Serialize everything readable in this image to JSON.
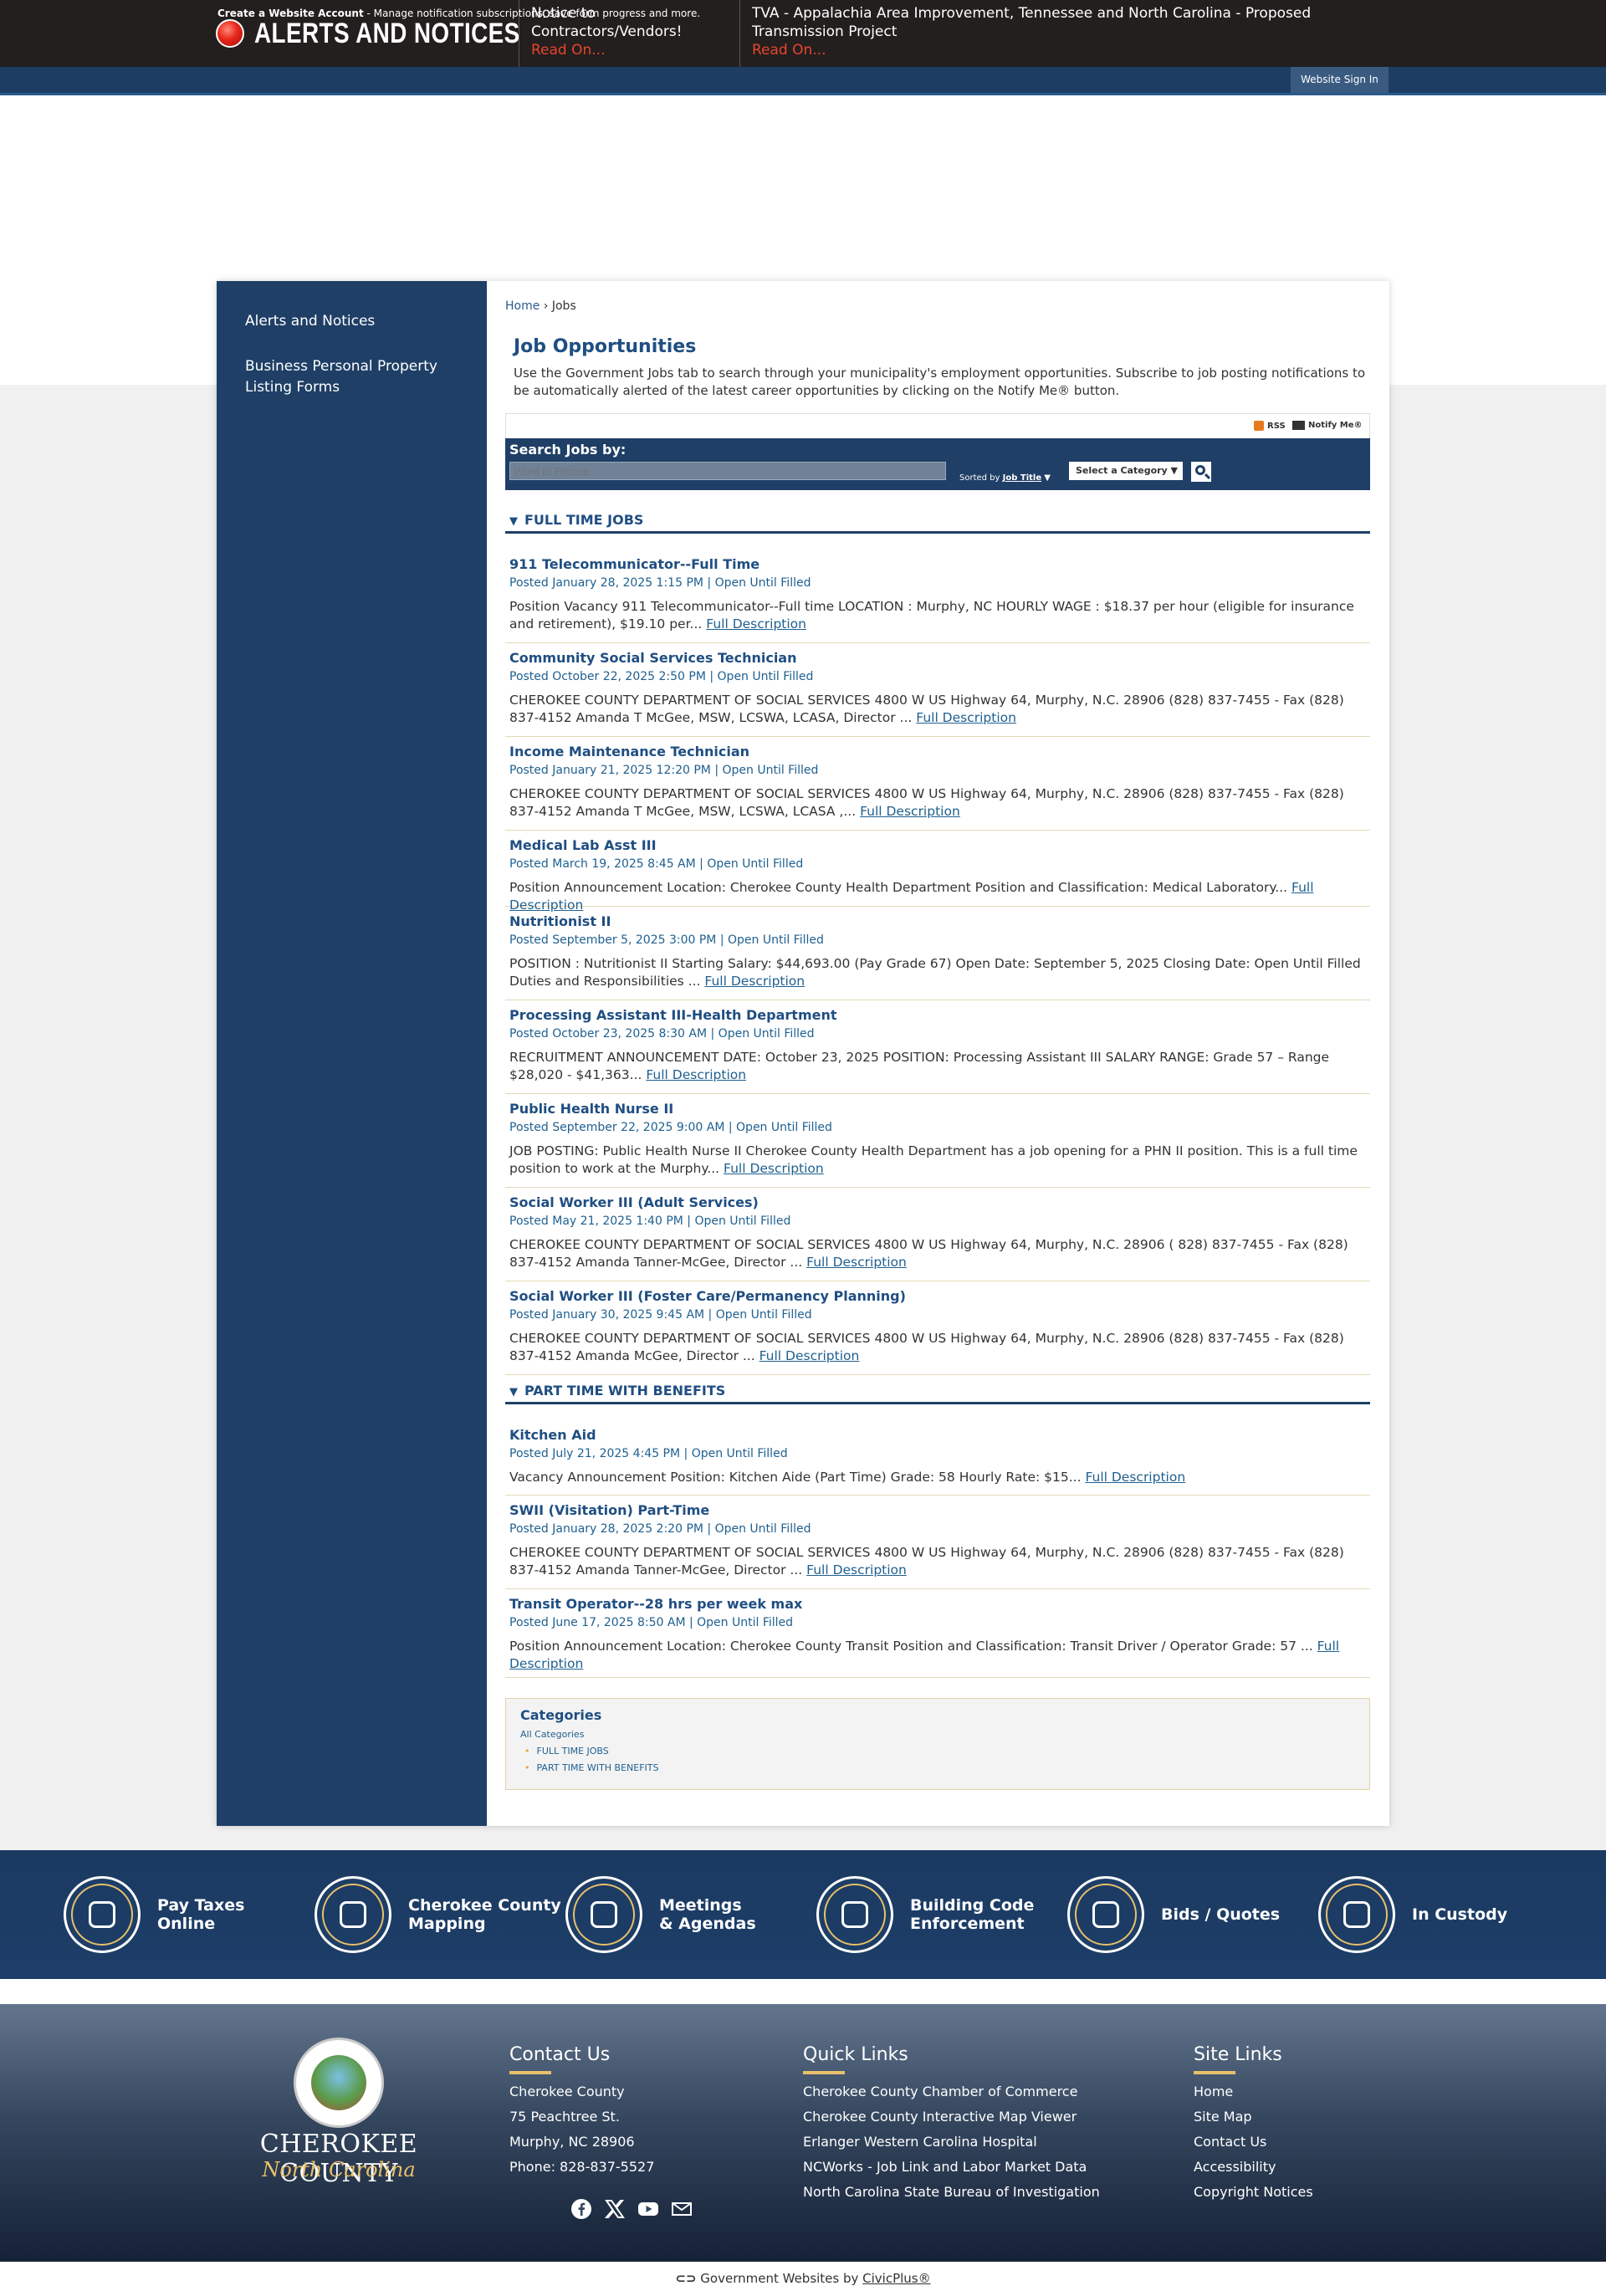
{
  "alerts": {
    "title": "ALERTS AND NOTICES",
    "items": [
      {
        "text": "Notice to Contractors/Vendors!",
        "read": "Read On..."
      },
      {
        "text": "TVA - Appalachia Area Improvement, Tennessee and North Carolina - Proposed Transmission Project",
        "read": "Read On..."
      }
    ]
  },
  "account": {
    "create": "Create a Website Account",
    "text": " - Manage notification subscriptions, save form progress and more.",
    "signin": "Website Sign In"
  },
  "sidebar": {
    "items": [
      "Alerts and Notices",
      "Business Personal Property Listing Forms"
    ]
  },
  "breadcrumb": {
    "home": "Home",
    "sep": "›",
    "current": "Jobs"
  },
  "page": {
    "title": "Job Opportunities",
    "intro": "Use the Government Jobs tab to search through your municipality's employment opportunities. Subscribe to job posting notifications to be automatically alerted of the latest career opportunities by clicking on the Notify Me® button."
  },
  "toolbar": {
    "rss": "RSS",
    "notify": "Notify Me®"
  },
  "search": {
    "label": "Search Jobs by:",
    "placeholder": "Word or Phrase",
    "sorted_by": "Sorted by",
    "sorted_field": "Job Title",
    "category": "Select a Category"
  },
  "sections": [
    {
      "title": "FULL TIME JOBS"
    },
    {
      "title": "PART TIME WITH BENEFITS"
    }
  ],
  "full_description_label": "Full Description",
  "jobs_full_time": [
    {
      "title": "911 Telecommunicator--Full Time",
      "posted": "Posted January 28, 2025 1:15 PM | Open Until Filled",
      "desc": "Position Vacancy 911 Telecommunicator--Full time LOCATION : Murphy, NC HOURLY WAGE : $18.37 per hour (eligible for insurance and retirement), $19.10 per..."
    },
    {
      "title": "Community Social Services Technician",
      "posted": "Posted October 22, 2025 2:50 PM | Open Until Filled",
      "desc": "CHEROKEE COUNTY DEPARTMENT OF SOCIAL SERVICES 4800 W US Highway 64, Murphy, N.C. 28906 (828) 837-7455 - Fax (828) 837-4152 Amanda T McGee, MSW, LCSWA, LCASA, Director ..."
    },
    {
      "title": "Income Maintenance Technician",
      "posted": "Posted January 21, 2025 12:20 PM | Open Until Filled",
      "desc": "CHEROKEE COUNTY DEPARTMENT OF SOCIAL SERVICES 4800 W US Highway 64, Murphy, N.C. 28906 (828) 837-7455 - Fax (828) 837-4152 Amanda T McGee, MSW, LCSWA, LCASA ,..."
    },
    {
      "title": "Medical Lab Asst III",
      "posted": "Posted March 19, 2025 8:45 AM | Open Until Filled",
      "desc": "Position Announcement Location: Cherokee County Health Department Position and Classification: Medical Laboratory..."
    },
    {
      "title": "Nutritionist II",
      "posted": "Posted September 5, 2025 3:00 PM | Open Until Filled",
      "desc": "POSITION : Nutritionist II Starting Salary: $44,693.00 (Pay Grade 67) Open Date: September 5, 2025 Closing Date: Open Until Filled Duties and Responsibilities ..."
    },
    {
      "title": "Processing Assistant III-Health Department",
      "posted": "Posted October 23, 2025 8:30 AM | Open Until Filled",
      "desc": "RECRUITMENT ANNOUNCEMENT DATE: October 23, 2025 POSITION: Processing Assistant III SALARY RANGE: Grade 57 – Range $28,020 - $41,363..."
    },
    {
      "title": "Public Health Nurse II",
      "posted": "Posted September 22, 2025 9:00 AM | Open Until Filled",
      "desc": "JOB POSTING: Public Health Nurse II Cherokee County Health Department has a job opening for a PHN II position. This is a full time position to work at the Murphy..."
    },
    {
      "title": "Social Worker III (Adult Services)",
      "posted": "Posted May 21, 2025 1:40 PM | Open Until Filled",
      "desc": "CHEROKEE COUNTY DEPARTMENT OF SOCIAL SERVICES 4800 W US Highway 64, Murphy, N.C. 28906 ( 828) 837-7455 - Fax (828) 837-4152 Amanda Tanner-McGee, Director ..."
    },
    {
      "title": "Social Worker III (Foster Care/Permanency Planning)",
      "posted": "Posted January 30, 2025 9:45 AM | Open Until Filled",
      "desc": "CHEROKEE COUNTY DEPARTMENT OF SOCIAL SERVICES 4800 W US Highway 64, Murphy, N.C. 28906 (828) 837-7455 - Fax (828) 837-4152 Amanda McGee, Director ..."
    }
  ],
  "jobs_part_time": [
    {
      "title": "Kitchen Aid",
      "posted": "Posted July 21, 2025 4:45 PM | Open Until Filled",
      "desc": "Vacancy Announcement Position: Kitchen Aide (Part Time) Grade: 58 Hourly Rate: $15..."
    },
    {
      "title": "SWII (Visitation) Part-Time",
      "posted": "Posted January 28, 2025 2:20 PM | Open Until Filled",
      "desc": "CHEROKEE COUNTY DEPARTMENT OF SOCIAL SERVICES 4800 W US Highway 64, Murphy, N.C. 28906 (828) 837-7455 - Fax (828) 837-4152 Amanda Tanner-McGee, Director ..."
    },
    {
      "title": "Transit Operator--28 hrs per week max",
      "posted": "Posted June 17, 2025 8:50 AM | Open Until Filled",
      "desc": "Position Announcement Location: Cherokee County Transit Position and Classification: Transit Driver / Operator Grade: 57 ..."
    }
  ],
  "categories": {
    "title": "Categories",
    "all": "All Categories",
    "items": [
      "FULL TIME JOBS",
      "PART TIME WITH BENEFITS"
    ]
  },
  "quick_links": [
    {
      "line1": "Pay Taxes",
      "line2": "Online",
      "icon": "tax-icon"
    },
    {
      "line1": "Cherokee County",
      "line2": "Mapping",
      "icon": "map-icon"
    },
    {
      "line1": "Meetings",
      "line2": "& Agendas",
      "icon": "calendar-icon"
    },
    {
      "line1": "Building Code",
      "line2": "Enforcement",
      "icon": "building-icon"
    },
    {
      "line1": "Bids / Quotes",
      "line2": "",
      "icon": "bids-icon"
    },
    {
      "line1": "In Custody",
      "line2": "",
      "icon": "custody-icon"
    }
  ],
  "footer": {
    "county": "CHEROKEE COUNTY",
    "state": "North Carolina",
    "contact_title": "Contact Us",
    "contact": [
      "Cherokee County",
      "75 Peachtree St.",
      "Murphy, NC 28906",
      "Phone: 828-837-5527"
    ],
    "quick_title": "Quick Links",
    "quick": [
      "Cherokee County Chamber of Commerce",
      "Cherokee County Interactive Map Viewer",
      "Erlanger Western Carolina Hospital",
      "NCWorks - Job Link and Labor Market Data",
      "North Carolina State Bureau of Investigation"
    ],
    "site_title": "Site Links",
    "site": [
      "Home",
      "Site Map",
      "Contact Us",
      "Accessibility",
      "Copyright Notices"
    ],
    "social": [
      "facebook-icon",
      "x-icon",
      "youtube-icon",
      "email-icon"
    ],
    "powered": "Government Websites by ",
    "powered_link": "CivicPlus®"
  }
}
